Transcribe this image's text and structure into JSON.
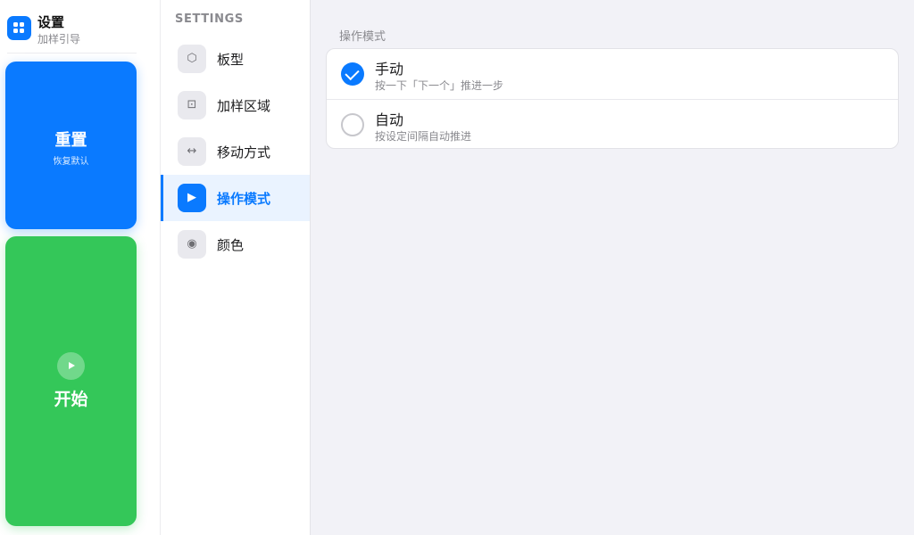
{
  "brand": {
    "title": "设置",
    "subtitle": "加样引导",
    "icon": "grid-icon",
    "color": "#0a7aff"
  },
  "actions": {
    "reset": {
      "label": "重置",
      "sub": "恢复默认",
      "color": "#0a7aff"
    },
    "start": {
      "label": "开始",
      "icon": "play-icon",
      "color": "#34c759"
    }
  },
  "nav": {
    "heading": "SETTINGS",
    "items": [
      {
        "label": "板型",
        "icon": "hexagon-icon",
        "glyph": "⬡",
        "active": false
      },
      {
        "label": "加样区域",
        "icon": "dotted-square-icon",
        "glyph": "⊡",
        "active": false
      },
      {
        "label": "移动方式",
        "icon": "arrows-horizontal-icon",
        "glyph": "↔",
        "active": false
      },
      {
        "label": "操作模式",
        "icon": "play-icon",
        "glyph": "▶",
        "active": true
      },
      {
        "label": "颜色",
        "icon": "radio-dot-icon",
        "glyph": "◉",
        "active": false
      }
    ]
  },
  "content": {
    "section_label": "操作模式",
    "options": [
      {
        "title": "手动",
        "desc": "按一下「下一个」推进一步",
        "selected": true
      },
      {
        "title": "自动",
        "desc": "按设定间隔自动推进",
        "selected": false
      }
    ]
  },
  "colors": {
    "accent": "#0a7aff",
    "start": "#34c759",
    "content_bg": "#f2f2f7"
  }
}
